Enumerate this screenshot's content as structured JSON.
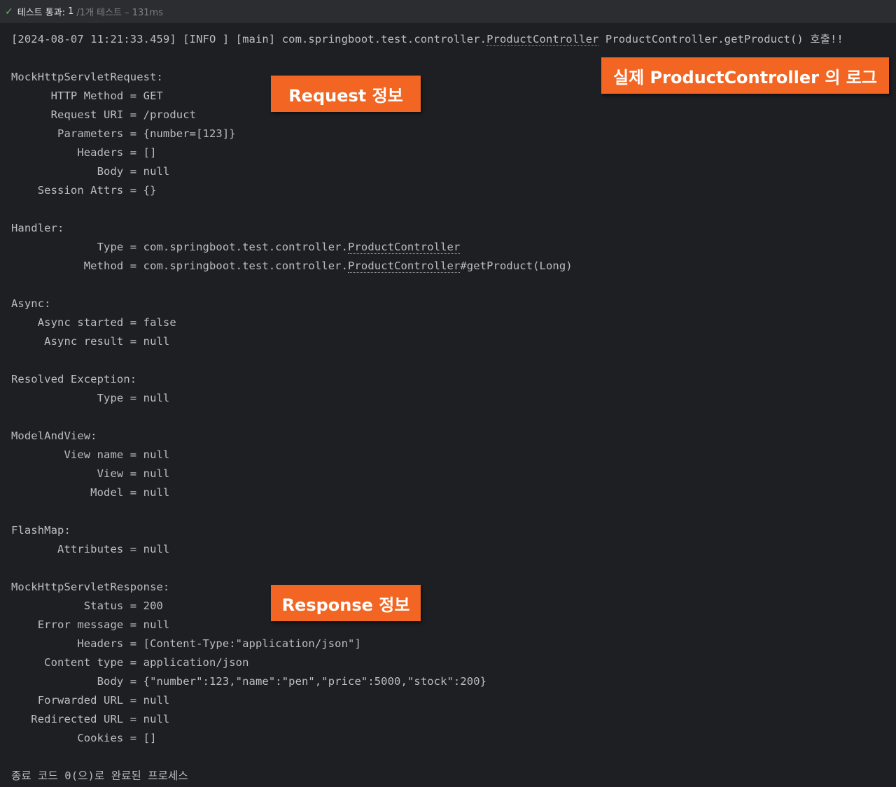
{
  "status": {
    "label": "테스트 통과:",
    "count": "1",
    "meta": "/1개 테스트 – 131ms"
  },
  "log": {
    "prefix": "[2024-08-07 11:21:33.459] [INFO ] [main] com.springboot.test.controller.",
    "class": "ProductController",
    "suffix": " ProductController.getProduct() 호출!!"
  },
  "request": {
    "header": "MockHttpServletRequest:",
    "http_method": "      HTTP Method = GET",
    "request_uri": "      Request URI = /product",
    "parameters": "       Parameters = {number=[123]}",
    "headers": "          Headers = []",
    "body": "             Body = null",
    "session_attrs": "    Session Attrs = {}"
  },
  "handler": {
    "header": "Handler:",
    "type_prefix": "             Type = com.springboot.test.controller.",
    "type_class": "ProductController",
    "method_prefix": "           Method = com.springboot.test.controller.",
    "method_class": "ProductController",
    "method_suffix": "#getProduct(Long)"
  },
  "async": {
    "header": "Async:",
    "started": "    Async started = false",
    "result": "     Async result = null"
  },
  "resolved": {
    "header": "Resolved Exception:",
    "type": "             Type = null"
  },
  "mav": {
    "header": "ModelAndView:",
    "view_name": "        View name = null",
    "view": "             View = null",
    "model": "            Model = null"
  },
  "flash": {
    "header": "FlashMap:",
    "attributes": "       Attributes = null"
  },
  "response": {
    "header": "MockHttpServletResponse:",
    "status": "           Status = 200",
    "error_message": "    Error message = null",
    "headers": "          Headers = [Content-Type:\"application/json\"]",
    "content_type": "     Content type = application/json",
    "body": "             Body = {\"number\":123,\"name\":\"pen\",\"price\":5000,\"stock\":200}",
    "forwarded_url": "    Forwarded URL = null",
    "redirected_url": "   Redirected URL = null",
    "cookies": "          Cookies = []"
  },
  "exit": "종료 코드 0(으)로 완료된 프로세스",
  "callouts": {
    "request": "Request 정보",
    "response": "Response 정보",
    "log": "실제 ProductController 의 로그"
  },
  "colors": {
    "background": "#1e1f22",
    "toolbar": "#2b2d30",
    "text": "#bcbec4",
    "callout": "#f26522",
    "pass": "#5fb865"
  }
}
